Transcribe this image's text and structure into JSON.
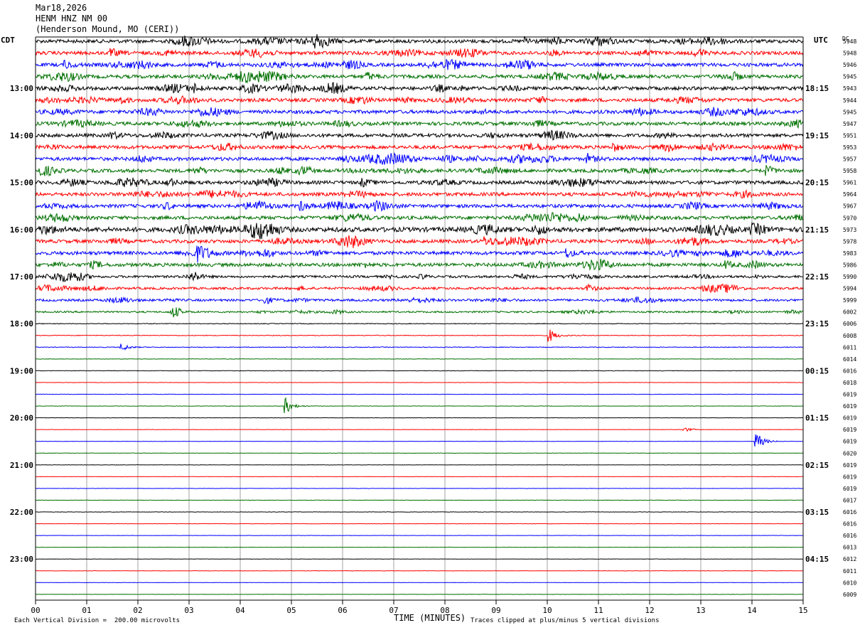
{
  "header": {
    "date": "Mar18,2026",
    "station": "HENM HNZ NM 00",
    "location": "(Henderson Mound, MO (CERI))"
  },
  "left_axis_label": "CDT",
  "right_axis_label": "UTC",
  "dc_label": "DC",
  "x_axis_title": "TIME (MINUTES)",
  "scale_note": "Each Vertical Division =  200.00 microvolts",
  "clip_note": "Traces clipped at plus/minus 5 vertical divisions",
  "chart_data": {
    "type": "line",
    "x_ticks": [
      "00",
      "01",
      "02",
      "03",
      "04",
      "05",
      "06",
      "07",
      "08",
      "09",
      "10",
      "11",
      "12",
      "13",
      "14",
      "15"
    ],
    "xlim": [
      0,
      15
    ],
    "trace_colors": [
      "#000000",
      "#ff0000",
      "#0000ff",
      "#007000"
    ],
    "left_time_labels": [
      "13:00",
      "14:00",
      "15:00",
      "16:00",
      "17:00",
      "18:00",
      "19:00",
      "20:00",
      "21:00",
      "22:00",
      "23:00"
    ],
    "right_time_labels": [
      "18:15",
      "19:15",
      "20:15",
      "21:15",
      "22:15",
      "23:15",
      "00:15",
      "01:15",
      "02:15",
      "03:15",
      "04:15"
    ],
    "dc_offsets": [
      "5948",
      "5948",
      "5946",
      "5945",
      "5943",
      "5944",
      "5945",
      "5947",
      "5951",
      "5953",
      "5957",
      "5958",
      "5961",
      "5964",
      "5967",
      "5970",
      "5973",
      "5978",
      "5983",
      "5986",
      "5990",
      "5994",
      "5999",
      "6002",
      "6006",
      "6008",
      "6011",
      "6014",
      "6016",
      "6018",
      "6019",
      "6019",
      "6019",
      "6019",
      "6019",
      "6020",
      "6019",
      "6019",
      "6019",
      "6017",
      "6016",
      "6016",
      "6016",
      "6013",
      "6012",
      "6011",
      "6010",
      "6009"
    ],
    "activity_levels": [
      3,
      3,
      3,
      3,
      3,
      3,
      3,
      3,
      3,
      3,
      3,
      3,
      3,
      3,
      3,
      3,
      4,
      3,
      3,
      3,
      2,
      2,
      2,
      1.5,
      0.6,
      0.6,
      0.6,
      0.4,
      0.4,
      0.3,
      0.3,
      0.3,
      0.3,
      0.3,
      0.3,
      0.3,
      0.3,
      0.3,
      0.3,
      0.3,
      0.3,
      0.3,
      0.3,
      0.3,
      0.3,
      0.3,
      0.3,
      0.3
    ],
    "events": [
      {
        "trace": 0,
        "minute": 5.5,
        "amplitude": 7
      },
      {
        "trace": 0,
        "minute": 9.6,
        "amplitude": 5
      },
      {
        "trace": 1,
        "minute": 1.5,
        "amplitude": 5
      },
      {
        "trace": 2,
        "minute": 0.6,
        "amplitude": 5
      },
      {
        "trace": 3,
        "minute": 6.5,
        "amplitude": 5
      },
      {
        "trace": 4,
        "minute": 3.1,
        "amplitude": 5
      },
      {
        "trace": 8,
        "minute": 1.5,
        "amplitude": 5
      },
      {
        "trace": 9,
        "minute": 11.3,
        "amplitude": 5
      },
      {
        "trace": 10,
        "minute": 10.8,
        "amplitude": 6
      },
      {
        "trace": 11,
        "minute": 14.3,
        "amplitude": 6
      },
      {
        "trace": 12,
        "minute": 2.6,
        "amplitude": 6
      },
      {
        "trace": 12,
        "minute": 6.4,
        "amplitude": 5
      },
      {
        "trace": 14,
        "minute": 5.2,
        "amplitude": 6
      },
      {
        "trace": 15,
        "minute": 10.6,
        "amplitude": 5
      },
      {
        "trace": 16,
        "minute": 14.0,
        "amplitude": 5
      },
      {
        "trace": 17,
        "minute": 8.8,
        "amplitude": 5
      },
      {
        "trace": 18,
        "minute": 3.2,
        "amplitude": 7
      },
      {
        "trace": 18,
        "minute": 10.4,
        "amplitude": 6
      },
      {
        "trace": 19,
        "minute": 13.5,
        "amplitude": 5
      },
      {
        "trace": 20,
        "minute": 3.1,
        "amplitude": 5
      },
      {
        "trace": 21,
        "minute": 10.8,
        "amplitude": 5
      },
      {
        "trace": 22,
        "minute": 4.5,
        "amplitude": 5
      },
      {
        "trace": 23,
        "minute": 2.7,
        "amplitude": 6
      },
      {
        "trace": 25,
        "minute": 10.05,
        "amplitude": 9
      },
      {
        "trace": 26,
        "minute": 1.7,
        "amplitude": 5
      },
      {
        "trace": 31,
        "minute": 4.9,
        "amplitude": 11
      },
      {
        "trace": 33,
        "minute": 12.7,
        "amplitude": 3
      },
      {
        "trace": 34,
        "minute": 14.1,
        "amplitude": 12
      }
    ]
  }
}
